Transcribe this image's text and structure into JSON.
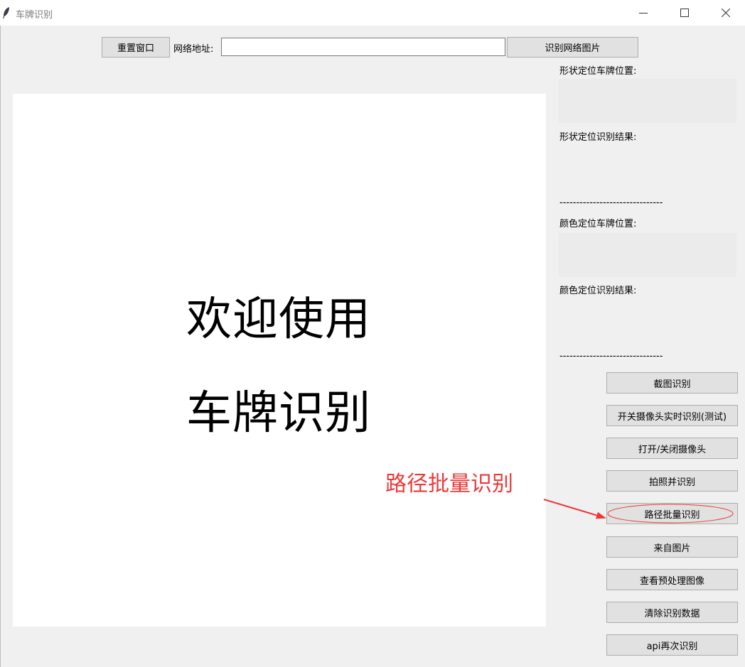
{
  "window": {
    "title": "车牌识别",
    "minimize_icon": "minimize-icon",
    "maximize_icon": "maximize-icon",
    "close_icon": "close-icon"
  },
  "toolbar": {
    "reset_label": "重置窗口",
    "url_label": "网络地址:",
    "url_value": "",
    "recognize_url_label": "识别网络图片"
  },
  "canvas": {
    "welcome_line1": "欢迎使用",
    "welcome_line2": "车牌识别"
  },
  "results": {
    "shape_position_label": "形状定位车牌位置:",
    "shape_result_label": "形状定位识别结果:",
    "separator": "-------------------------------",
    "color_position_label": "颜色定位车牌位置:",
    "color_result_label": "颜色定位识别结果:"
  },
  "actions": [
    {
      "label": "截图识别"
    },
    {
      "label": "开关摄像头实时识别(测试)"
    },
    {
      "label": "打开/关闭摄像头"
    },
    {
      "label": "拍照并识别"
    },
    {
      "label": "路径批量识别"
    },
    {
      "label": "来自图片"
    },
    {
      "label": "查看预处理图像"
    },
    {
      "label": "清除识别数据"
    },
    {
      "label": "api再次识别"
    }
  ],
  "annotation": {
    "text": "路径批量识别",
    "color": "#ea3a3a"
  }
}
